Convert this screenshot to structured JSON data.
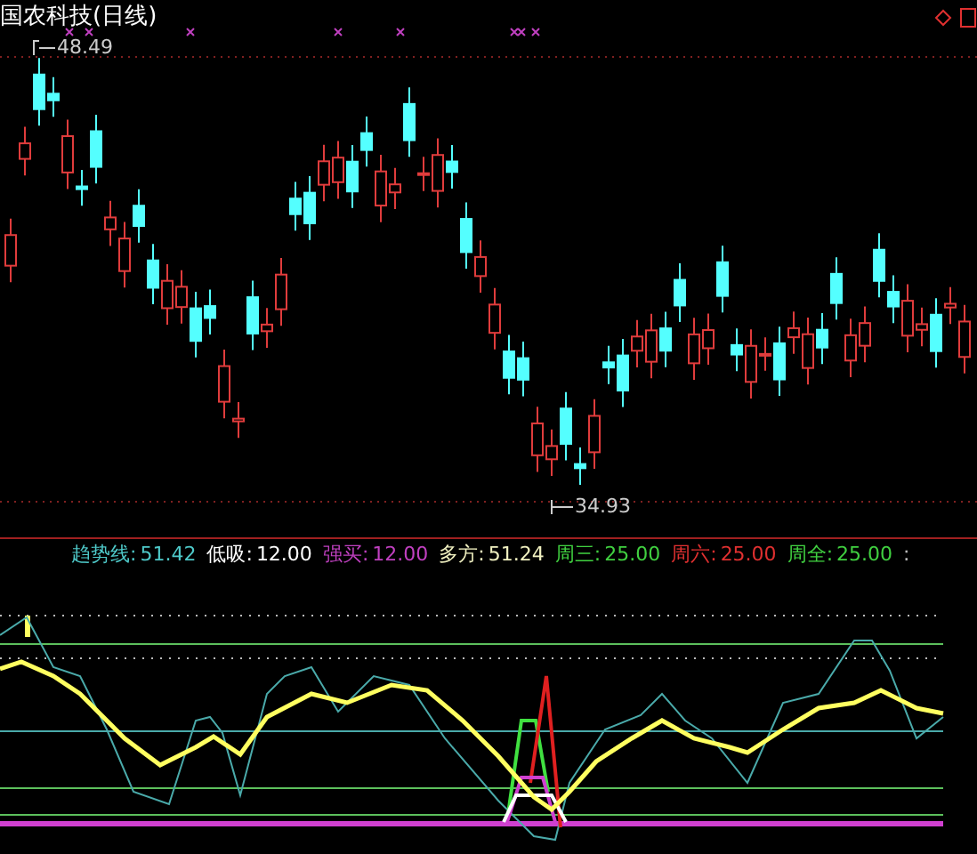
{
  "main_chart": {
    "title": "国农科技(日线)",
    "high_label": "48.49",
    "low_label": "34.93"
  },
  "indicator_legend": [
    {
      "label": "趋势线:",
      "value": "51.42",
      "color": "#4ec9c9"
    },
    {
      "label": "低吸:",
      "value": "12.00",
      "color": "#ffffff"
    },
    {
      "label": "强买:",
      "value": "12.00",
      "color": "#c040c0"
    },
    {
      "label": "多方:",
      "value": "51.24",
      "color": "#f0f0c0"
    },
    {
      "label": "周三:",
      "value": "25.00",
      "color": "#40d040"
    },
    {
      "label": "周六:",
      "value": "25.00",
      "color": "#e03030"
    },
    {
      "label": "周全:",
      "value": "25.00",
      "color": "#40d040"
    },
    {
      "label": ":",
      "color": "#c0c0c0"
    }
  ]
}
